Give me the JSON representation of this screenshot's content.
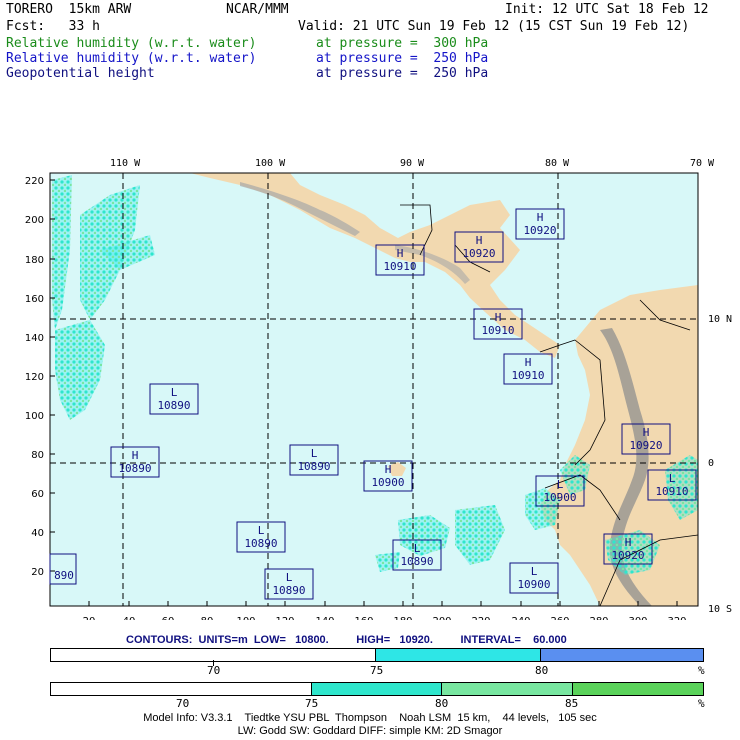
{
  "header": {
    "model": "TORERO  15km ARW",
    "center": "NCAR/MMM",
    "init": "Init: 12 UTC Sat 18 Feb 12",
    "fcst": "Fcst:   33 h",
    "valid": "Valid: 21 UTC Sun 19 Feb 12 (15 CST Sun 19 Feb 12)",
    "fields": [
      {
        "name": "Relative humidity (w.r.t. water)",
        "level": "at pressure =  300 hPa",
        "color": "#1a8c1a"
      },
      {
        "name": "Relative humidity (w.r.t. water)",
        "level": "at pressure =  250 hPa",
        "color": "#1414c8"
      },
      {
        "name": "Geopotential height",
        "level": "at pressure =  250 hPa",
        "color": "#101080"
      }
    ]
  },
  "map": {
    "top_lon_labels": [
      "110 W",
      "100 W",
      "90 W",
      "80 W",
      "70 W"
    ],
    "right_lat_labels": [
      "10 N",
      "0",
      "10 S"
    ],
    "left_grid_labels": [
      "220",
      "200",
      "180",
      "160",
      "140",
      "120",
      "100",
      "80",
      "60",
      "40",
      "20"
    ],
    "bottom_grid_labels": [
      "20",
      "40",
      "60",
      "80",
      "100",
      "120",
      "140",
      "160",
      "180",
      "200",
      "220",
      "240",
      "260",
      "280",
      "300",
      "320"
    ],
    "centers": [
      {
        "type": "H",
        "value": "10920"
      },
      {
        "type": "H",
        "value": "10920"
      },
      {
        "type": "H",
        "value": "10910"
      },
      {
        "type": "H",
        "value": "10910"
      },
      {
        "type": "H",
        "value": "10910"
      },
      {
        "type": "L",
        "value": "10890"
      },
      {
        "type": "H",
        "value": "10890"
      },
      {
        "type": "L",
        "value": "10890"
      },
      {
        "type": "H",
        "value": "10900"
      },
      {
        "type": "L",
        "value": "10890"
      },
      {
        "type": "L",
        "value": "10890"
      },
      {
        "type": "L",
        "value": "10890"
      },
      {
        "type": "L",
        "value": "10900"
      },
      {
        "type": "H",
        "value": "10920"
      },
      {
        "type": "L",
        "value": "10900"
      },
      {
        "type": "L",
        "value": "10910"
      },
      {
        "type": "H",
        "value": "10920"
      },
      {
        "type": "",
        "value": "890"
      }
    ],
    "colors": {
      "ocean": "#d8f8f8",
      "land": "#f2d9b0",
      "mountain": "#9a9a9a",
      "contour_box": "#101080"
    }
  },
  "contours": {
    "text": "CONTOURS:  UNITS=m  LOW=   10800.         HIGH=   10920.         INTERVAL=    60.000"
  },
  "colorbar_250": {
    "labels": [
      "70",
      "75",
      "80",
      "%"
    ],
    "colors": [
      "#ffffff",
      "#2ee6e6",
      "#5a8ff0"
    ]
  },
  "colorbar_300": {
    "labels": [
      "70",
      "75",
      "80",
      "85",
      "%"
    ],
    "colors": [
      "#ffffff",
      "#2ee6cc",
      "#78e6a0",
      "#5ad25a"
    ]
  },
  "footer": {
    "line1": "Model Info: V3.3.1    Tiedtke YSU PBL  Thompson    Noah LSM  15 km,    44 levels,   105 sec",
    "line2": "LW: Godd SW: Goddard DIFF: simple KM: 2D Smagor"
  }
}
